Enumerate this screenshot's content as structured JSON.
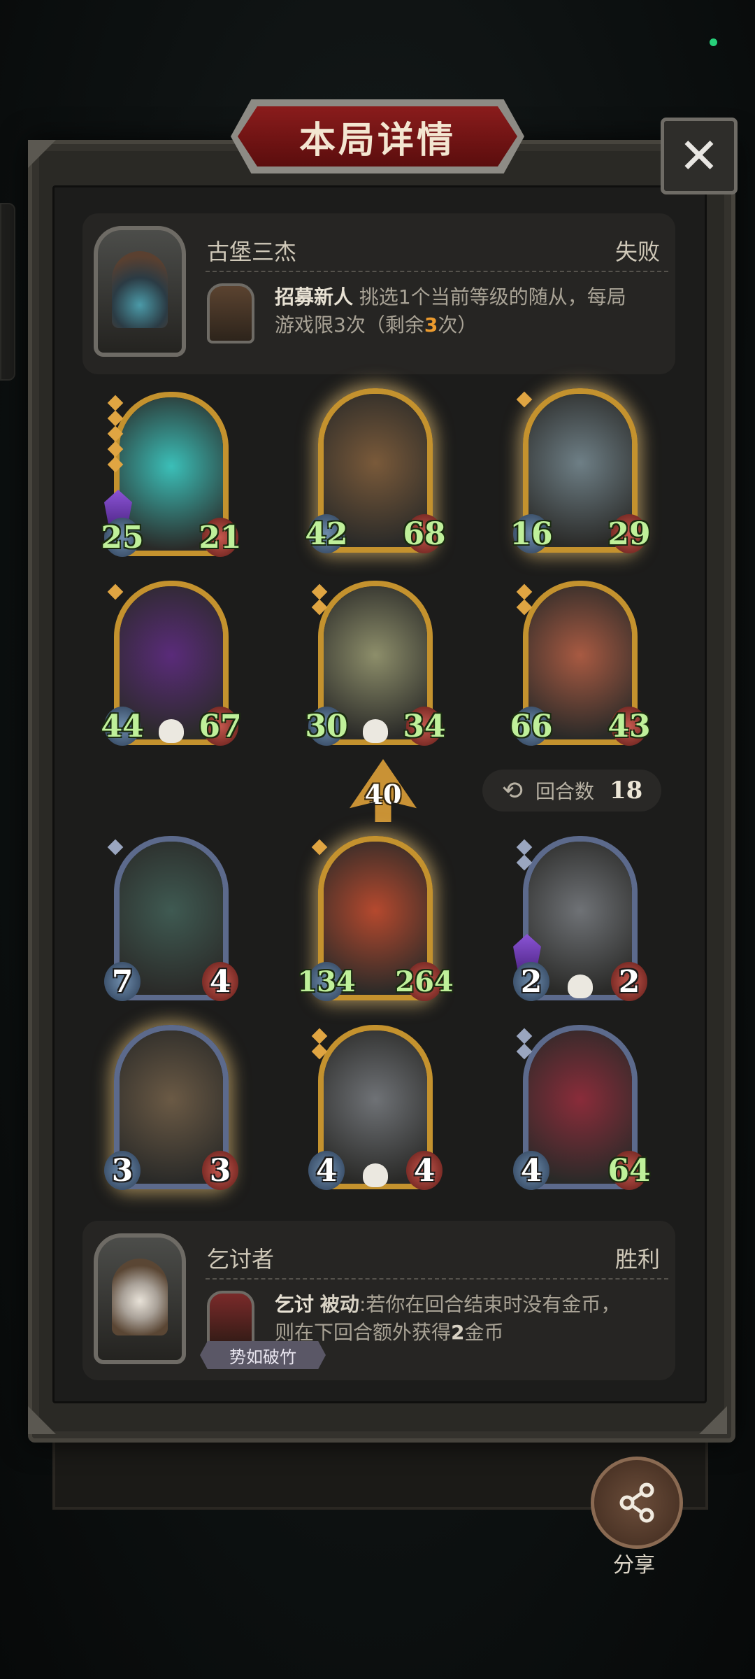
{
  "title": "本局详情",
  "close_label": "✕",
  "opponent": {
    "name": "古堡三杰",
    "result": "失败",
    "ability_name": "招募新人",
    "ability_desc_1": "挑选1个当前等级的随从，每局",
    "ability_desc_2a": "游戏限3次（剩余",
    "ability_remaining": "3",
    "ability_desc_2b": "次）"
  },
  "enemy_minions": [
    {
      "attack": "25",
      "health": "21",
      "frame": "gold",
      "stars": 5,
      "shield": true,
      "skull": false,
      "art": "ghost-viking",
      "color": "#3bbfb8"
    },
    {
      "attack": "42",
      "health": "68",
      "frame": "gold",
      "stars": 0,
      "shield": false,
      "skull": false,
      "art": "pumpkin-golem",
      "color": "#7a5a3a",
      "glow": true
    },
    {
      "attack": "16",
      "health": "29",
      "frame": "gold",
      "stars": 1,
      "shield": false,
      "skull": false,
      "art": "ghost-ship",
      "color": "#6e7f86",
      "glow": true
    },
    {
      "attack": "44",
      "health": "67",
      "frame": "gold",
      "stars": 1,
      "shield": false,
      "skull": true,
      "art": "hooded-reaper",
      "color": "#5a2b7a"
    },
    {
      "attack": "30",
      "health": "34",
      "frame": "gold",
      "stars": 2,
      "shield": false,
      "skull": true,
      "art": "robot",
      "color": "#8d8e6a"
    },
    {
      "attack": "66",
      "health": "43",
      "frame": "gold",
      "stars": 2,
      "shield": false,
      "skull": false,
      "art": "siren",
      "color": "#a85a42"
    }
  ],
  "tier": "40",
  "turn": {
    "label": "回合数",
    "value": "18"
  },
  "player_minions": [
    {
      "attack": "7",
      "health": "4",
      "frame": "blue",
      "stars": 1,
      "shield": false,
      "skull": false,
      "art": "succubus",
      "color": "#3f5a52",
      "white": true
    },
    {
      "attack": "134",
      "health": "264",
      "frame": "gold",
      "stars": 1,
      "shield": false,
      "skull": false,
      "art": "red-robot",
      "color": "#b5492e",
      "glow": true
    },
    {
      "attack": "2",
      "health": "2",
      "frame": "blue",
      "stars": 2,
      "shield": true,
      "skull": true,
      "art": "trash-bot",
      "color": "#6f7276",
      "white": true
    },
    {
      "attack": "3",
      "health": "3",
      "frame": "blue",
      "stars": 0,
      "shield": false,
      "skull": false,
      "art": "zeppelin",
      "color": "#6b5a45",
      "glow": true,
      "white": true
    },
    {
      "attack": "4",
      "health": "4",
      "frame": "gold",
      "stars": 2,
      "shield": false,
      "skull": true,
      "art": "trash-bot",
      "color": "#6f7276",
      "white": true
    },
    {
      "attack": "4",
      "health": "64",
      "frame": "blue",
      "stars": 2,
      "shield": false,
      "skull": false,
      "art": "clown",
      "color": "#8a2c3a",
      "white_atk": true
    }
  ],
  "player": {
    "name": "乞讨者",
    "result": "胜利",
    "ability_name": "乞讨",
    "ability_type": "被动",
    "ability_desc_1": ":若你在回合结束时没有金币，",
    "ability_desc_2a": "则在下回合额外获得",
    "ability_amount": "2",
    "ability_desc_2b": "金币",
    "tag": "势如破竹"
  },
  "share_label": "分享"
}
